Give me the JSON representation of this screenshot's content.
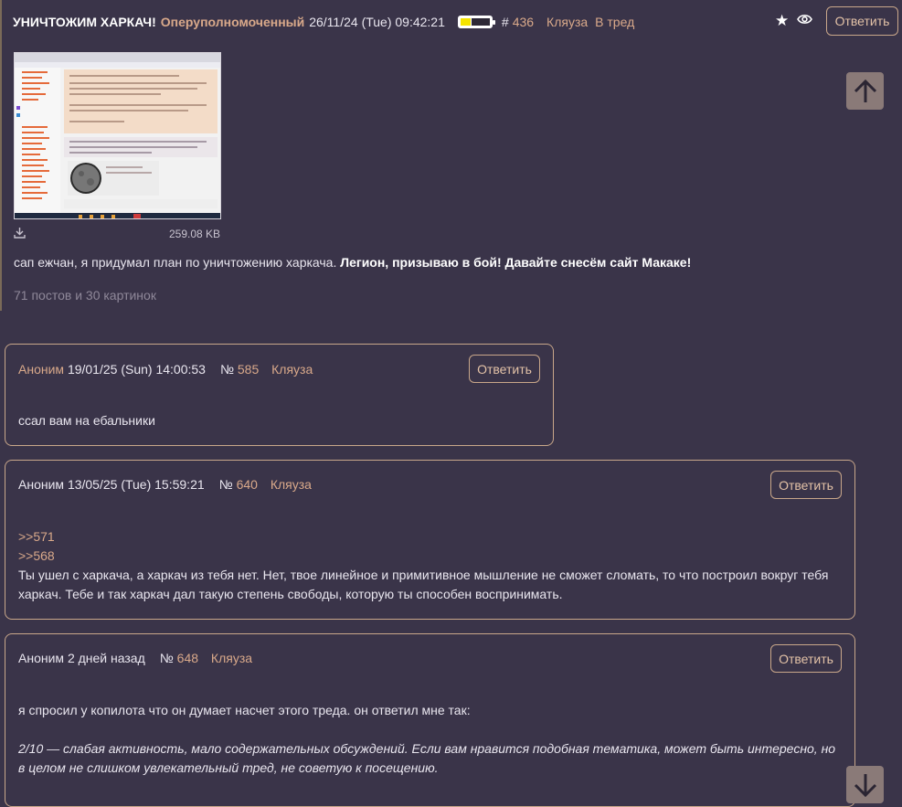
{
  "op": {
    "title": "УНИЧТОЖИМ ХАРКАЧ!",
    "author": "Оперуполномоченный",
    "date": "26/11/24 (Tue) 09:42:21",
    "battery_level": 0.35,
    "hash_label": "#",
    "number": "436",
    "tag": "Кляуза",
    "to_thread": "В тред",
    "reply_label": "Ответить",
    "file_size": "259.08 KB",
    "text_plain": "сап ежчан, я придумал план по уничтожению харкача.",
    "text_bold": "Легион, призываю в бой! Давайте снесём сайт Макаке!",
    "stats": "71 постов и 30 картинок"
  },
  "posts": [
    {
      "author": "Аноним",
      "date": "19/01/25 (Sun) 14:00:53",
      "num_label": "№",
      "number": "585",
      "tag": "Кляуза",
      "reply_label": "Ответить",
      "text": "ссал вам на ебальники"
    },
    {
      "author": "Аноним",
      "date": "13/05/25 (Tue) 15:59:21",
      "num_label": "№",
      "number": "640",
      "tag": "Кляуза",
      "reply_label": "Ответить",
      "quote1": ">>571",
      "quote2": ">>568",
      "line1": "Ты ушел с харкача, а харкач из тебя нет. Нет, твое линейное и примитивное мышление не сможет сломать, то что построил вокруг тебя",
      "line2": "харкач. Тебе и так харкач дал такую степень свободы, которую ты способен воспринимать."
    },
    {
      "author": "Аноним",
      "date": "2 дней назад",
      "num_label": "№",
      "number": "648",
      "tag": "Кляуза",
      "reply_label": "Ответить",
      "line1": "я спросил у копилота что он думает насчет этого треда. он ответил мне так:",
      "line2": "2/10 — слабая активность, мало содержательных обсуждений. Если вам нравится подобная тематика, может быть интересно, но",
      "line3": "в целом не слишком увлекательный тред, не советую к посещению."
    }
  ],
  "icons": {
    "star": "star-icon",
    "eye": "eye-icon",
    "download": "download-icon",
    "up": "arrow-up-icon",
    "down": "arrow-down-icon"
  },
  "colors": {
    "background": "#3a3449",
    "accent": "#d9a98a",
    "border": "#c9a78a"
  }
}
